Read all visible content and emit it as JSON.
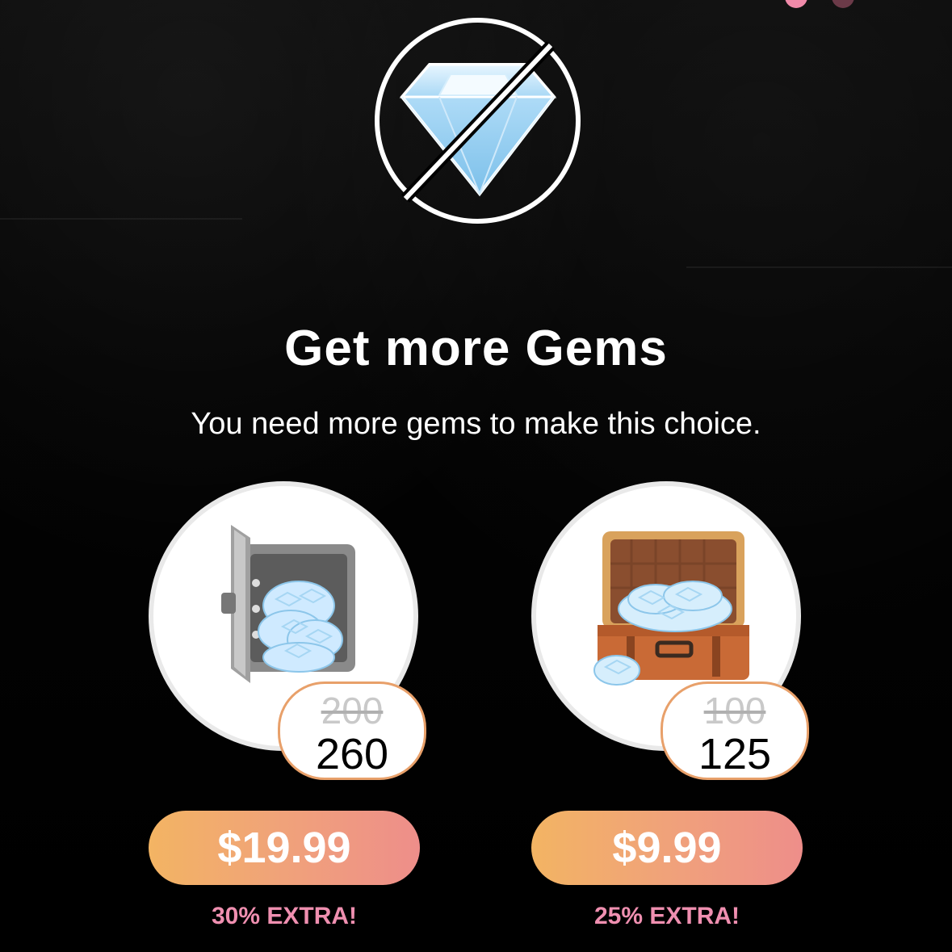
{
  "dialog": {
    "title": "Get more Gems",
    "subtitle": "You need more gems to make this choice."
  },
  "packs": [
    {
      "icon": "safe-with-gems-icon",
      "old_amount": "200",
      "new_amount": "260",
      "price": "$19.99",
      "extra": "30% EXTRA!"
    },
    {
      "icon": "suitcase-with-gems-icon",
      "old_amount": "100",
      "new_amount": "125",
      "price": "$9.99",
      "extra": "25% EXTRA!"
    }
  ],
  "colors": {
    "background": "#050505",
    "button_gradient_start": "#f3b463",
    "button_gradient_end": "#ee8e8a",
    "extra_text": "#ef8fb0",
    "pill_border": "#e8a06a"
  }
}
